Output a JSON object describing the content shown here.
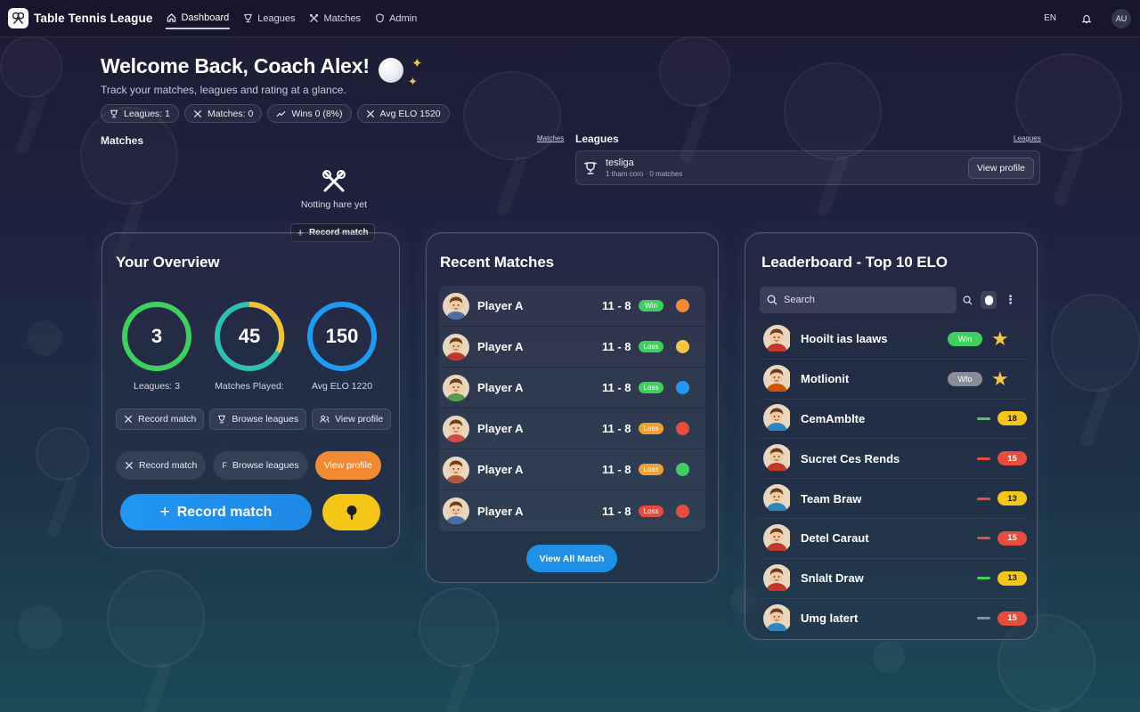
{
  "nav": {
    "app_title": "Table Tennis League",
    "links": [
      {
        "label": "Dashboard",
        "icon": "home-icon",
        "active": true
      },
      {
        "label": "Leagues",
        "icon": "trophy-icon",
        "active": false
      },
      {
        "label": "Matches",
        "icon": "crossed-paddles-icon",
        "active": false
      },
      {
        "label": "Admin",
        "icon": "shield-icon",
        "active": false
      }
    ],
    "language": "EN",
    "avatar_initials": "AU"
  },
  "hero": {
    "title": "Welcome Back, Coach Alex!",
    "subtitle": "Track your matches, leagues and rating at a glance."
  },
  "stats_chips": [
    {
      "label": "Leagues: 1",
      "icon": "trophy-icon"
    },
    {
      "label": "Matches: 0",
      "icon": "crossed-paddles-icon"
    },
    {
      "label": "Wins 0 (8%)",
      "icon": "trend-icon"
    },
    {
      "label": "Avg ELO 1520",
      "icon": "crossed-paddles-icon"
    }
  ],
  "matches_section": {
    "label": "Matches",
    "link": "Matches",
    "empty_text": "Notting hare yet",
    "record_button": "Record match"
  },
  "leagues_section": {
    "label": "Leagues",
    "link": "Leagues",
    "league_name": "tesliga",
    "league_meta": "1 tham coro · 0 matches",
    "view_profile": "View profile"
  },
  "overview": {
    "title": "Your Overview",
    "rings": [
      {
        "value": "3",
        "label": "Leagues: 3",
        "progress": 1.0,
        "colors": [
          "#3ecf5e"
        ]
      },
      {
        "value": "45",
        "label": "Matches Played:",
        "progress": 1.0,
        "colors": [
          "#2fc0b0",
          "#f0c23a"
        ]
      },
      {
        "value": "150",
        "label": "Avg ELO 1220",
        "progress": 1.0,
        "colors": [
          "#1e9bf0"
        ]
      }
    ],
    "small_buttons": [
      {
        "label": "Record match",
        "icon": "crossed-paddles-icon"
      },
      {
        "label": "Browse leagues",
        "icon": "trophy-icon"
      },
      {
        "label": "View profile",
        "icon": "users-icon"
      }
    ],
    "pill_buttons": [
      {
        "label": "Record match",
        "icon": "crossed-paddles-icon"
      },
      {
        "label": "Browse leagues",
        "icon": "f-icon"
      },
      {
        "label": "View profile",
        "icon": ""
      }
    ],
    "big_button": "Record match"
  },
  "recent": {
    "title": "Recent Matches",
    "matches": [
      {
        "player": "Player A",
        "score": "11 - 8",
        "badge": "Win",
        "badge_color": "#3ecf5e",
        "dot": "#f08a35",
        "avatar_shirt": "#4a6fa5"
      },
      {
        "player": "Player A",
        "score": "11 - 8",
        "badge": "Loss",
        "badge_color": "#3ecf5e",
        "dot": "#f6c342",
        "avatar_shirt": "#c0392b"
      },
      {
        "player": "Player A",
        "score": "11 - 8",
        "badge": "Loss",
        "badge_color": "#3ecf5e",
        "dot": "#1e9bf0",
        "avatar_shirt": "#5a9a4e"
      },
      {
        "player": "Player A",
        "score": "11 - 8",
        "badge": "Loss",
        "badge_color": "#f0a030",
        "dot": "#e74c3c",
        "avatar_shirt": "#d04a4a"
      },
      {
        "player": "Player A",
        "score": "11 - 8",
        "badge": "Loss",
        "badge_color": "#f0a030",
        "dot": "#3ecf5e",
        "avatar_shirt": "#b25a3a"
      },
      {
        "player": "Player A",
        "score": "11 - 8",
        "badge": "Loss",
        "badge_color": "#e74c3c",
        "dot": "#e74c3c",
        "avatar_shirt": "#4a6fa5"
      }
    ],
    "view_all": "View All Match"
  },
  "leaderboard": {
    "title": "Leaderboard - Top 10 ELO",
    "search_placeholder": "Search",
    "rows": [
      {
        "name": "Hooilt ias laaws",
        "kind": "win",
        "badge": "Win",
        "badge_color": "#3ecf5e",
        "star": true
      },
      {
        "name": "Motlionit",
        "kind": "win",
        "badge": "Wfo",
        "badge_color": "#8a8d99",
        "star": true
      },
      {
        "name": "CemAmblte",
        "kind": "elo",
        "dash": "#3ecf5e",
        "elo": "18",
        "elo_color": "#f5c518"
      },
      {
        "name": "Sucret Ces Rends",
        "kind": "elo",
        "dash": "#e74c3c",
        "elo": "15",
        "elo_color": "#e74c3c"
      },
      {
        "name": "Team Braw",
        "kind": "elo",
        "dash": "#e74c3c",
        "elo": "13",
        "elo_color": "#f5c518"
      },
      {
        "name": "Detel Caraut",
        "kind": "elo",
        "dash": "#e74c3c",
        "elo": "15",
        "elo_color": "#e74c3c"
      },
      {
        "name": "Snlalt Draw",
        "kind": "elo",
        "dash": "#3ecf5e",
        "elo": "13",
        "elo_color": "#f5c518"
      },
      {
        "name": "Umg latert",
        "kind": "elo",
        "dash": "#8a8d99",
        "elo": "15",
        "elo_color": "#e74c3c"
      }
    ]
  }
}
